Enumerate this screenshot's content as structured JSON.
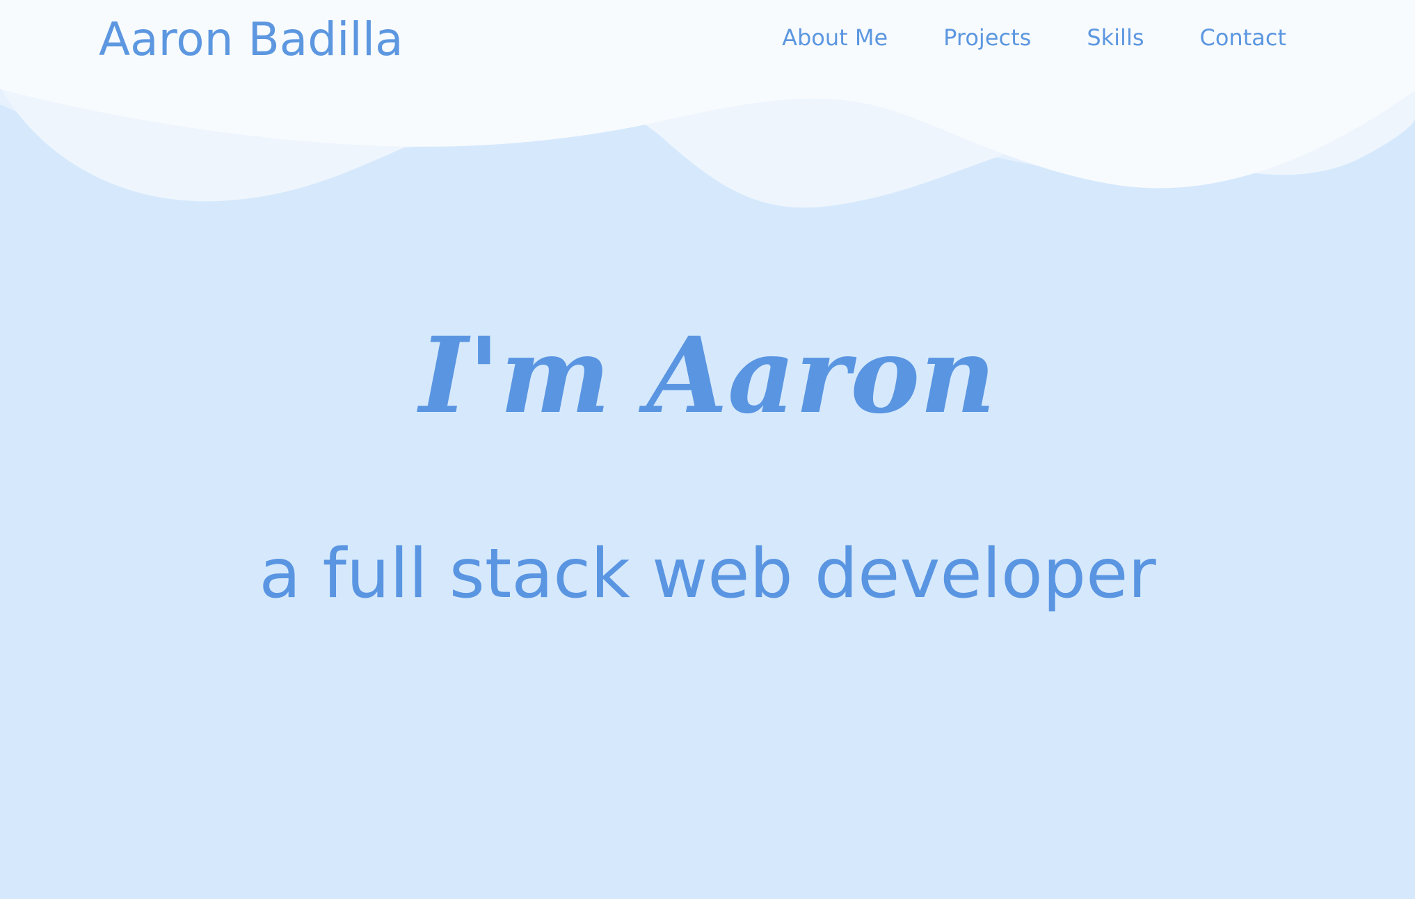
{
  "header": {
    "brand": "Aaron Badilla",
    "nav": {
      "about": "About Me",
      "projects": "Projects",
      "skills": "Skills",
      "contact": "Contact"
    }
  },
  "hero": {
    "title": "I'm Aaron",
    "subtitle": "a full stack web developer"
  },
  "colors": {
    "accent": "#5a95e2",
    "background": "#d6e9fc",
    "header_wave": "#f8fbfe"
  }
}
